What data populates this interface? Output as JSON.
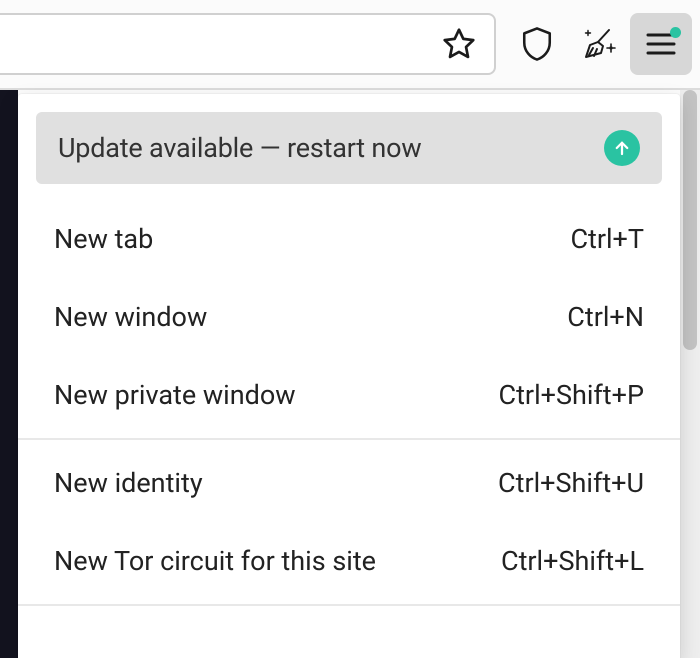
{
  "banner": {
    "text": "Update available — restart now"
  },
  "menu": {
    "groups": [
      [
        {
          "label": "New tab",
          "shortcut": "Ctrl+T"
        },
        {
          "label": "New window",
          "shortcut": "Ctrl+N"
        },
        {
          "label": "New private window",
          "shortcut": "Ctrl+Shift+P"
        }
      ],
      [
        {
          "label": "New identity",
          "shortcut": "Ctrl+Shift+U"
        },
        {
          "label": "New Tor circuit for this site",
          "shortcut": "Ctrl+Shift+L"
        }
      ]
    ]
  }
}
